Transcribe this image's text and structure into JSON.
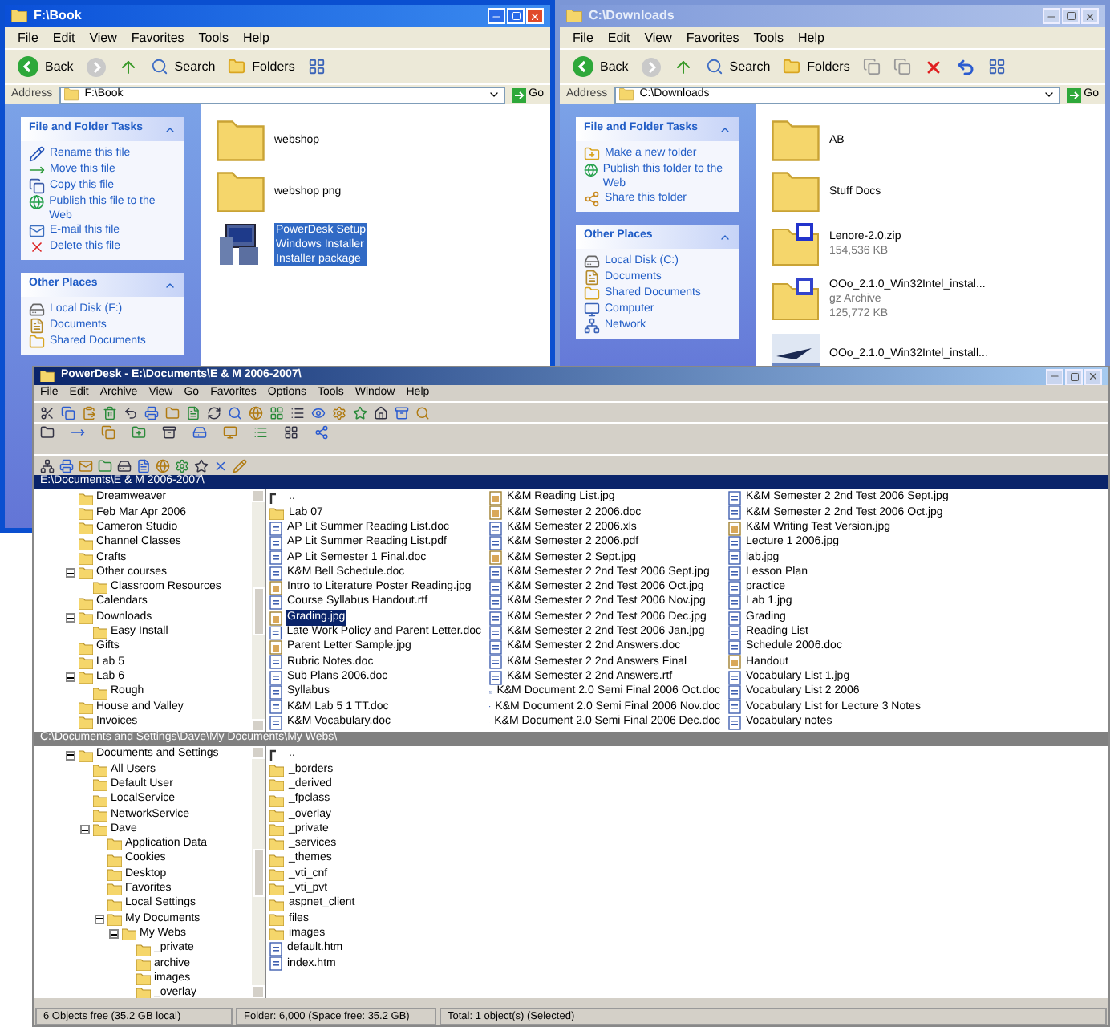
{
  "explorers": [
    {
      "title": "F:\\Book",
      "active": true,
      "edit_tools": false,
      "menu": [
        "File",
        "Edit",
        "View",
        "Favorites",
        "Tools",
        "Help"
      ],
      "toolbar": [
        "Back",
        "Search",
        "Folders"
      ],
      "address_label": "Address",
      "address": "F:\\Book",
      "go": "Go",
      "panels": [
        {
          "title": "File and Folder Tasks",
          "items": [
            {
              "kind": "rename",
              "label": "Rename this file"
            },
            {
              "kind": "move",
              "label": "Move this file"
            },
            {
              "kind": "copy",
              "label": "Copy this file"
            },
            {
              "kind": "web",
              "label": "Publish this file to the Web"
            },
            {
              "kind": "mail",
              "label": "E-mail this file"
            },
            {
              "kind": "delete",
              "label": "Delete this file"
            }
          ]
        },
        {
          "title": "Other Places",
          "items": [
            {
              "kind": "disk",
              "label": "Local Disk (F:)"
            },
            {
              "kind": "docs",
              "label": "Documents"
            },
            {
              "kind": "shared",
              "label": "Shared Documents"
            }
          ]
        }
      ],
      "files": [
        {
          "kind": "folder",
          "lines": [
            "webshop"
          ],
          "selected": false
        },
        {
          "kind": "folder",
          "lines": [
            "webshop png"
          ],
          "selected": false
        },
        {
          "kind": "installer",
          "lines": [
            "PowerDesk Setup",
            "Windows Installer",
            "Installer package"
          ],
          "selected": true
        }
      ]
    },
    {
      "title": "C:\\Downloads",
      "active": false,
      "edit_tools": true,
      "menu": [
        "File",
        "Edit",
        "View",
        "Favorites",
        "Tools",
        "Help"
      ],
      "toolbar": [
        "Back",
        "Search",
        "Folders"
      ],
      "address_label": "Address",
      "address": "C:\\Downloads",
      "go": "Go",
      "panels": [
        {
          "title": "File and Folder Tasks",
          "items": [
            {
              "kind": "newfolder",
              "label": "Make a new folder"
            },
            {
              "kind": "web",
              "label": "Publish this folder to the Web"
            },
            {
              "kind": "share",
              "label": "Share this folder"
            }
          ]
        },
        {
          "title": "Other Places",
          "items": [
            {
              "kind": "disk",
              "label": "Local Disk (C:)"
            },
            {
              "kind": "docs",
              "label": "Documents"
            },
            {
              "kind": "shared",
              "label": "Shared Documents"
            },
            {
              "kind": "computer",
              "label": "Computer"
            },
            {
              "kind": "network",
              "label": "Network"
            }
          ]
        }
      ],
      "files": [
        {
          "kind": "folder",
          "lines": [
            "AB"
          ],
          "selected": false
        },
        {
          "kind": "folder",
          "lines": [
            "Stuff Docs"
          ],
          "selected": false
        },
        {
          "kind": "zip",
          "lines": [
            "Lenore-2.0.zip",
            "154,536 KB"
          ],
          "selected": false
        },
        {
          "kind": "archive",
          "lines": [
            "OOo_2.1.0_Win32Intel_instal...",
            "gz Archive",
            "125,772 KB"
          ],
          "selected": false
        },
        {
          "kind": "setup",
          "lines": [
            "OOo_2.1.0_Win32Intel_install..."
          ],
          "selected": false
        }
      ]
    }
  ],
  "powerdesk": {
    "title": "PowerDesk - E:\\Documents\\E & M 2006-2007\\",
    "menu": [
      "File",
      "Edit",
      "Archive",
      "View",
      "Go",
      "Favorites",
      "Options",
      "Tools",
      "Window",
      "Help"
    ],
    "top": {
      "path": "E:\\Documents\\E & M 2006-2007\\",
      "tree": [
        {
          "label": "Dreamweaver"
        },
        {
          "label": "Feb Mar Apr 2006"
        },
        {
          "label": "Cameron Studio"
        },
        {
          "label": "Channel Classes"
        },
        {
          "label": "Crafts"
        },
        {
          "label": "Other courses",
          "children": [
            {
              "label": "Classroom Resources"
            }
          ]
        },
        {
          "label": "Calendars"
        },
        {
          "label": "Downloads",
          "children": [
            {
              "label": "Easy Install"
            }
          ]
        },
        {
          "label": "Gifts"
        },
        {
          "label": "Lab 5"
        },
        {
          "label": "Lab 6",
          "children": [
            {
              "label": "Rough"
            }
          ]
        },
        {
          "label": "House and Valley"
        },
        {
          "label": "Invoices"
        }
      ],
      "columns": [
        [
          {
            "kind": "up",
            "name": "..",
            "selected": false
          },
          {
            "kind": "folder",
            "name": "Lab 07",
            "selected": false
          },
          {
            "kind": "doc",
            "name": "AP Lit Summer Reading List.doc",
            "selected": false
          },
          {
            "kind": "doc",
            "name": "AP Lit Summer Reading List.pdf",
            "selected": false
          },
          {
            "kind": "doc",
            "name": "AP Lit Semester 1 Final.doc",
            "selected": false
          },
          {
            "kind": "doc",
            "name": "K&M Bell Schedule.doc",
            "selected": false
          },
          {
            "kind": "image",
            "name": "Intro to Literature Poster Reading.jpg",
            "selected": false
          },
          {
            "kind": "doc",
            "name": "Course Syllabus Handout.rtf",
            "selected": false
          },
          {
            "kind": "image",
            "name": "Grading.jpg",
            "selected": true
          },
          {
            "kind": "doc",
            "name": "Late Work Policy and Parent Letter.doc",
            "selected": false
          },
          {
            "kind": "image",
            "name": "Parent Letter Sample.jpg",
            "selected": false
          },
          {
            "kind": "doc",
            "name": "Rubric Notes.doc",
            "selected": false
          },
          {
            "kind": "doc",
            "name": "Sub Plans 2006.doc",
            "selected": false
          },
          {
            "kind": "doc",
            "name": "Syllabus",
            "selected": false
          },
          {
            "kind": "doc",
            "name": "K&M Lab 5 1 TT.doc",
            "selected": false
          },
          {
            "kind": "doc",
            "name": "K&M Vocabulary.doc",
            "selected": false
          }
        ],
        [
          {
            "kind": "image",
            "name": "K&M Reading List.jpg",
            "selected": false
          },
          {
            "kind": "image",
            "name": "K&M Semester 2 2006.doc",
            "selected": false
          },
          {
            "kind": "doc",
            "name": "K&M Semester 2 2006.xls",
            "selected": false
          },
          {
            "kind": "doc",
            "name": "K&M Semester 2 2006.pdf",
            "selected": false
          },
          {
            "kind": "image",
            "name": "K&M Semester 2 Sept.jpg",
            "selected": false
          },
          {
            "kind": "doc",
            "name": "K&M Semester 2 2nd Test 2006 Sept.jpg",
            "selected": false
          },
          {
            "kind": "doc",
            "name": "K&M Semester 2 2nd Test 2006 Oct.jpg",
            "selected": false
          },
          {
            "kind": "doc",
            "name": "K&M Semester 2 2nd Test 2006 Nov.jpg",
            "selected": false
          },
          {
            "kind": "doc",
            "name": "K&M Semester 2 2nd Test 2006 Dec.jpg",
            "selected": false
          },
          {
            "kind": "doc",
            "name": "K&M Semester 2 2nd Test 2006 Jan.jpg",
            "selected": false
          },
          {
            "kind": "doc",
            "name": "K&M Semester 2 2nd Answers.doc",
            "selected": false
          },
          {
            "kind": "doc",
            "name": "K&M Semester 2 2nd Answers Final",
            "selected": false
          },
          {
            "kind": "doc",
            "name": "K&M Semester 2 2nd Answers.rtf",
            "selected": false
          },
          {
            "kind": "doc",
            "name": "K&M Document 2.0 Semi Final 2006 Oct.doc",
            "selected": false
          },
          {
            "kind": "doc",
            "name": "K&M Document 2.0 Semi Final 2006 Nov.doc",
            "selected": false
          },
          {
            "kind": "doc",
            "name": "K&M Document 2.0 Semi Final 2006 Dec.doc",
            "selected": false
          }
        ],
        [
          {
            "kind": "doc",
            "name": "K&M Semester 2 2nd Test 2006 Sept.jpg",
            "selected": false
          },
          {
            "kind": "doc",
            "name": "K&M Semester 2 2nd Test 2006 Oct.jpg",
            "selected": false
          },
          {
            "kind": "image",
            "name": "K&M Writing Test Version.jpg",
            "selected": false
          },
          {
            "kind": "doc",
            "name": "Lecture 1 2006.jpg",
            "selected": false
          },
          {
            "kind": "doc",
            "name": "lab.jpg",
            "selected": false
          },
          {
            "kind": "doc",
            "name": "Lesson Plan",
            "selected": false
          },
          {
            "kind": "doc",
            "name": "practice",
            "selected": false
          },
          {
            "kind": "doc",
            "name": "Lab 1.jpg",
            "selected": false
          },
          {
            "kind": "doc",
            "name": "Grading",
            "selected": false
          },
          {
            "kind": "doc",
            "name": "Reading List",
            "selected": false
          },
          {
            "kind": "doc",
            "name": "Schedule 2006.doc",
            "selected": false
          },
          {
            "kind": "image",
            "name": "Handout",
            "selected": false
          },
          {
            "kind": "doc",
            "name": "Vocabulary List 1.jpg",
            "selected": false
          },
          {
            "kind": "doc",
            "name": "Vocabulary List 2 2006",
            "selected": false
          },
          {
            "kind": "doc",
            "name": "Vocabulary List for Lecture 3 Notes",
            "selected": false
          },
          {
            "kind": "doc",
            "name": "Vocabulary notes",
            "selected": false
          }
        ]
      ]
    },
    "bottom": {
      "path": "C:\\Documents and Settings\\Dave\\My Documents\\My Webs\\",
      "tree": [
        {
          "label": "Documents and Settings",
          "children": [
            {
              "label": "All Users"
            },
            {
              "label": "Default User"
            },
            {
              "label": "LocalService"
            },
            {
              "label": "NetworkService"
            },
            {
              "label": "Dave",
              "children": [
                {
                  "label": "Application Data"
                },
                {
                  "label": "Cookies"
                },
                {
                  "label": "Desktop"
                },
                {
                  "label": "Favorites"
                },
                {
                  "label": "Local Settings"
                },
                {
                  "label": "My Documents",
                  "children": [
                    {
                      "label": "My Webs",
                      "children": [
                        {
                          "label": "_private"
                        },
                        {
                          "label": "archive"
                        },
                        {
                          "label": "images"
                        },
                        {
                          "label": "_overlay"
                        }
                      ]
                    }
                  ]
                }
              ]
            }
          ]
        }
      ],
      "columns": [
        [
          {
            "kind": "up",
            "name": "..",
            "selected": false
          },
          {
            "kind": "folder",
            "name": "_borders",
            "selected": false
          },
          {
            "kind": "folder",
            "name": "_derived",
            "selected": false
          },
          {
            "kind": "folder",
            "name": "_fpclass",
            "selected": false
          },
          {
            "kind": "folder",
            "name": "_overlay",
            "selected": false
          },
          {
            "kind": "folder",
            "name": "_private",
            "selected": false
          },
          {
            "kind": "folder",
            "name": "_services",
            "selected": false
          },
          {
            "kind": "folder",
            "name": "_themes",
            "selected": false
          },
          {
            "kind": "folder",
            "name": "_vti_cnf",
            "selected": false
          },
          {
            "kind": "folder",
            "name": "_vti_pvt",
            "selected": false
          },
          {
            "kind": "folder",
            "name": "aspnet_client",
            "selected": false
          },
          {
            "kind": "folder",
            "name": "files",
            "selected": false
          },
          {
            "kind": "folder",
            "name": "images",
            "selected": false
          },
          {
            "kind": "doc",
            "name": "default.htm",
            "selected": false
          },
          {
            "kind": "doc",
            "name": "index.htm",
            "selected": false
          }
        ]
      ]
    },
    "status": [
      "6 Objects free (35.2 GB local)",
      "Folder: 6,000 (Space free: 35.2 GB)",
      "Total: 1 object(s) (Selected)"
    ]
  }
}
